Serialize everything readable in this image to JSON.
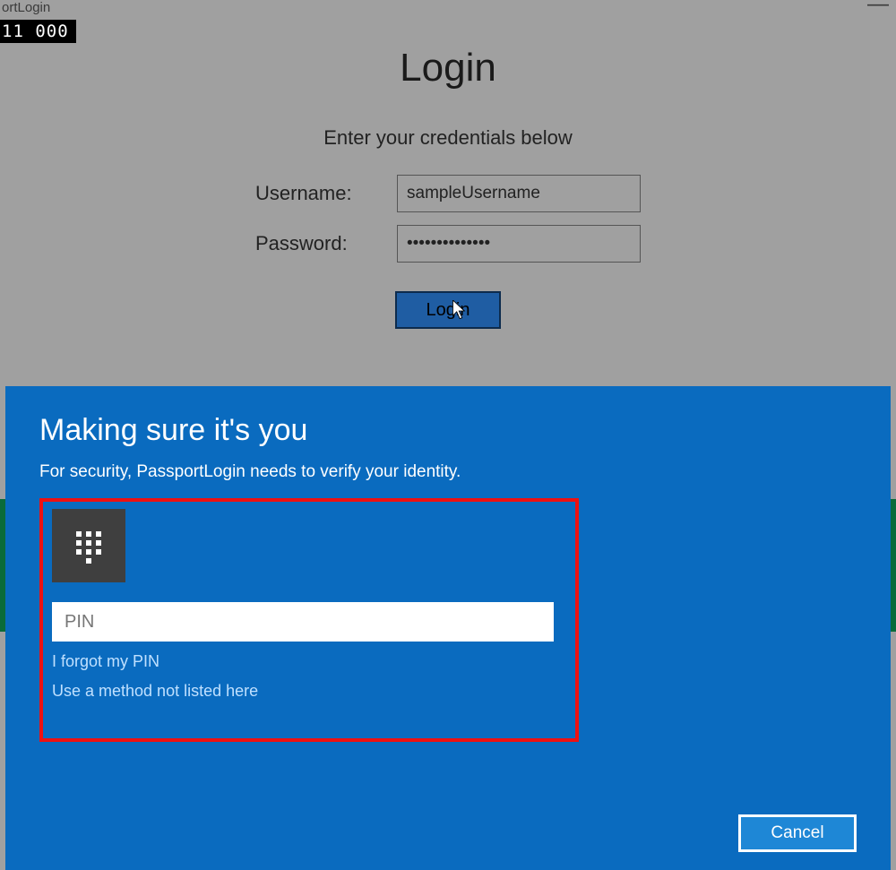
{
  "window": {
    "title_fragment": "ortLogin",
    "counter": "11   000"
  },
  "login": {
    "heading": "Login",
    "subheading": "Enter your credentials below",
    "username_label": "Username:",
    "username_value": "sampleUsername",
    "password_label": "Password:",
    "password_value": "••••••••••••••",
    "button_label": "Login"
  },
  "dialog": {
    "title": "Making sure it's you",
    "subtitle": "For security, PassportLogin needs to verify your identity.",
    "pin_placeholder": "PIN",
    "forgot_link": "I forgot my PIN",
    "other_method_link": "Use a method not listed here",
    "cancel_label": "Cancel"
  }
}
